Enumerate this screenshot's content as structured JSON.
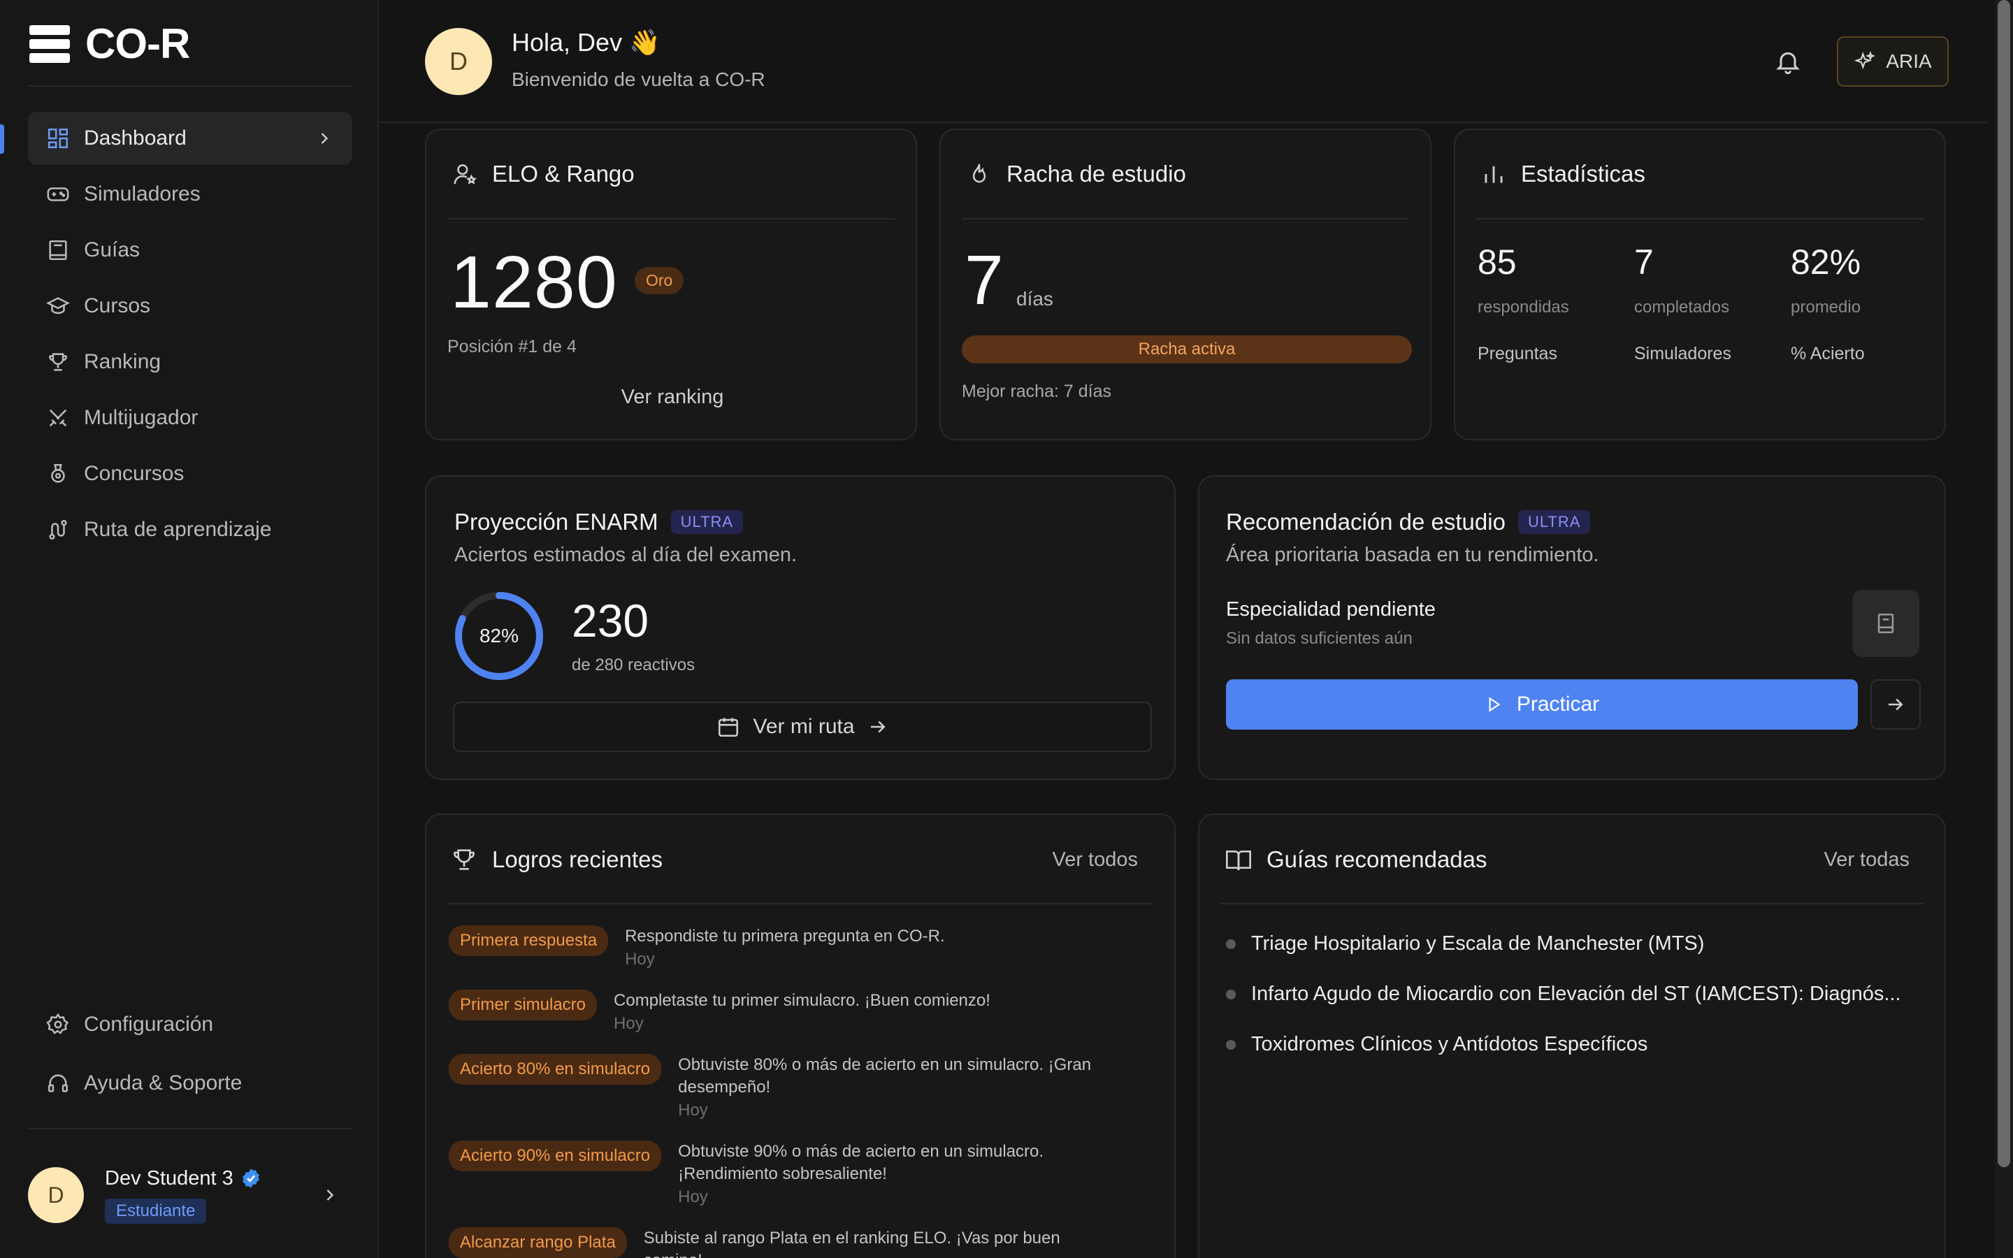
{
  "app": {
    "logo_text": "CO-R"
  },
  "sidebar": {
    "items": [
      {
        "label": "Dashboard",
        "icon": "dashboard-icon"
      },
      {
        "label": "Simuladores",
        "icon": "gamepad-icon"
      },
      {
        "label": "Guías",
        "icon": "book-icon"
      },
      {
        "label": "Cursos",
        "icon": "graduation-cap-icon"
      },
      {
        "label": "Ranking",
        "icon": "trophy-icon"
      },
      {
        "label": "Multijugador",
        "icon": "swords-icon"
      },
      {
        "label": "Concursos",
        "icon": "medal-icon"
      },
      {
        "label": "Ruta de aprendizaje",
        "icon": "route-icon"
      }
    ],
    "bottom": [
      {
        "label": "Configuración",
        "icon": "gear-icon"
      },
      {
        "label": "Ayuda & Soporte",
        "icon": "headphones-icon"
      }
    ],
    "user": {
      "initial": "D",
      "name": "Dev Student 3",
      "role": "Estudiante"
    }
  },
  "header": {
    "avatar_initial": "D",
    "greeting": "Hola, Dev 👋",
    "subtitle": "Bienvenido de vuelta a CO-R",
    "aria_label": "ARIA"
  },
  "elo": {
    "title": "ELO & Rango",
    "value": "1280",
    "rank": "Oro",
    "position": "Posición #1 de 4",
    "link": "Ver ranking"
  },
  "streak": {
    "title": "Racha de estudio",
    "days": "7",
    "unit": "días",
    "status": "Racha activa",
    "best": "Mejor racha: 7 días"
  },
  "stats": {
    "title": "Estadísticas",
    "items": [
      {
        "value": "85",
        "sub": "respondidas",
        "label": "Preguntas"
      },
      {
        "value": "7",
        "sub": "completados",
        "label": "Simuladores"
      },
      {
        "value": "82%",
        "sub": "promedio",
        "label": "% Acierto"
      }
    ]
  },
  "projection": {
    "title": "Proyección ENARM",
    "badge": "ULTRA",
    "subtitle": "Aciertos estimados al día del examen.",
    "percent_label": "82%",
    "percent": 82,
    "value": "230",
    "of_label": "de 280 reactivos",
    "button": "Ver mi ruta",
    "accent": "#4f83f1"
  },
  "recommendation": {
    "title": "Recomendación de estudio",
    "badge": "ULTRA",
    "subtitle": "Área prioritaria basada en tu rendimiento.",
    "item_title": "Especialidad pendiente",
    "item_sub": "Sin datos suficientes aún",
    "button": "Practicar"
  },
  "achievements": {
    "title": "Logros recientes",
    "link": "Ver todos",
    "items": [
      {
        "badge": "Primera respuesta",
        "text": "Respondiste tu primera pregunta en CO-R.",
        "time": "Hoy"
      },
      {
        "badge": "Primer simulacro",
        "text": "Completaste tu primer simulacro. ¡Buen comienzo!",
        "time": "Hoy"
      },
      {
        "badge": "Acierto 80% en simulacro",
        "text": "Obtuviste 80% o más de acierto en un simulacro. ¡Gran desempeño!",
        "time": "Hoy"
      },
      {
        "badge": "Acierto 90% en simulacro",
        "text": "Obtuviste 90% o más de acierto en un simulacro. ¡Rendimiento sobresaliente!",
        "time": "Hoy"
      },
      {
        "badge": "Alcanzar rango Plata",
        "text": "Subiste al rango Plata en el ranking ELO. ¡Vas por buen camino!",
        "time": ""
      }
    ]
  },
  "guides": {
    "title": "Guías recomendadas",
    "link": "Ver todas",
    "items": [
      "Triage Hospitalario y Escala de Manchester (MTS)",
      "Infarto Agudo de Miocardio con Elevación del ST (IAMCEST): Diagnós...",
      "Toxidromes Clínicos y Antídotos Específicos"
    ]
  }
}
